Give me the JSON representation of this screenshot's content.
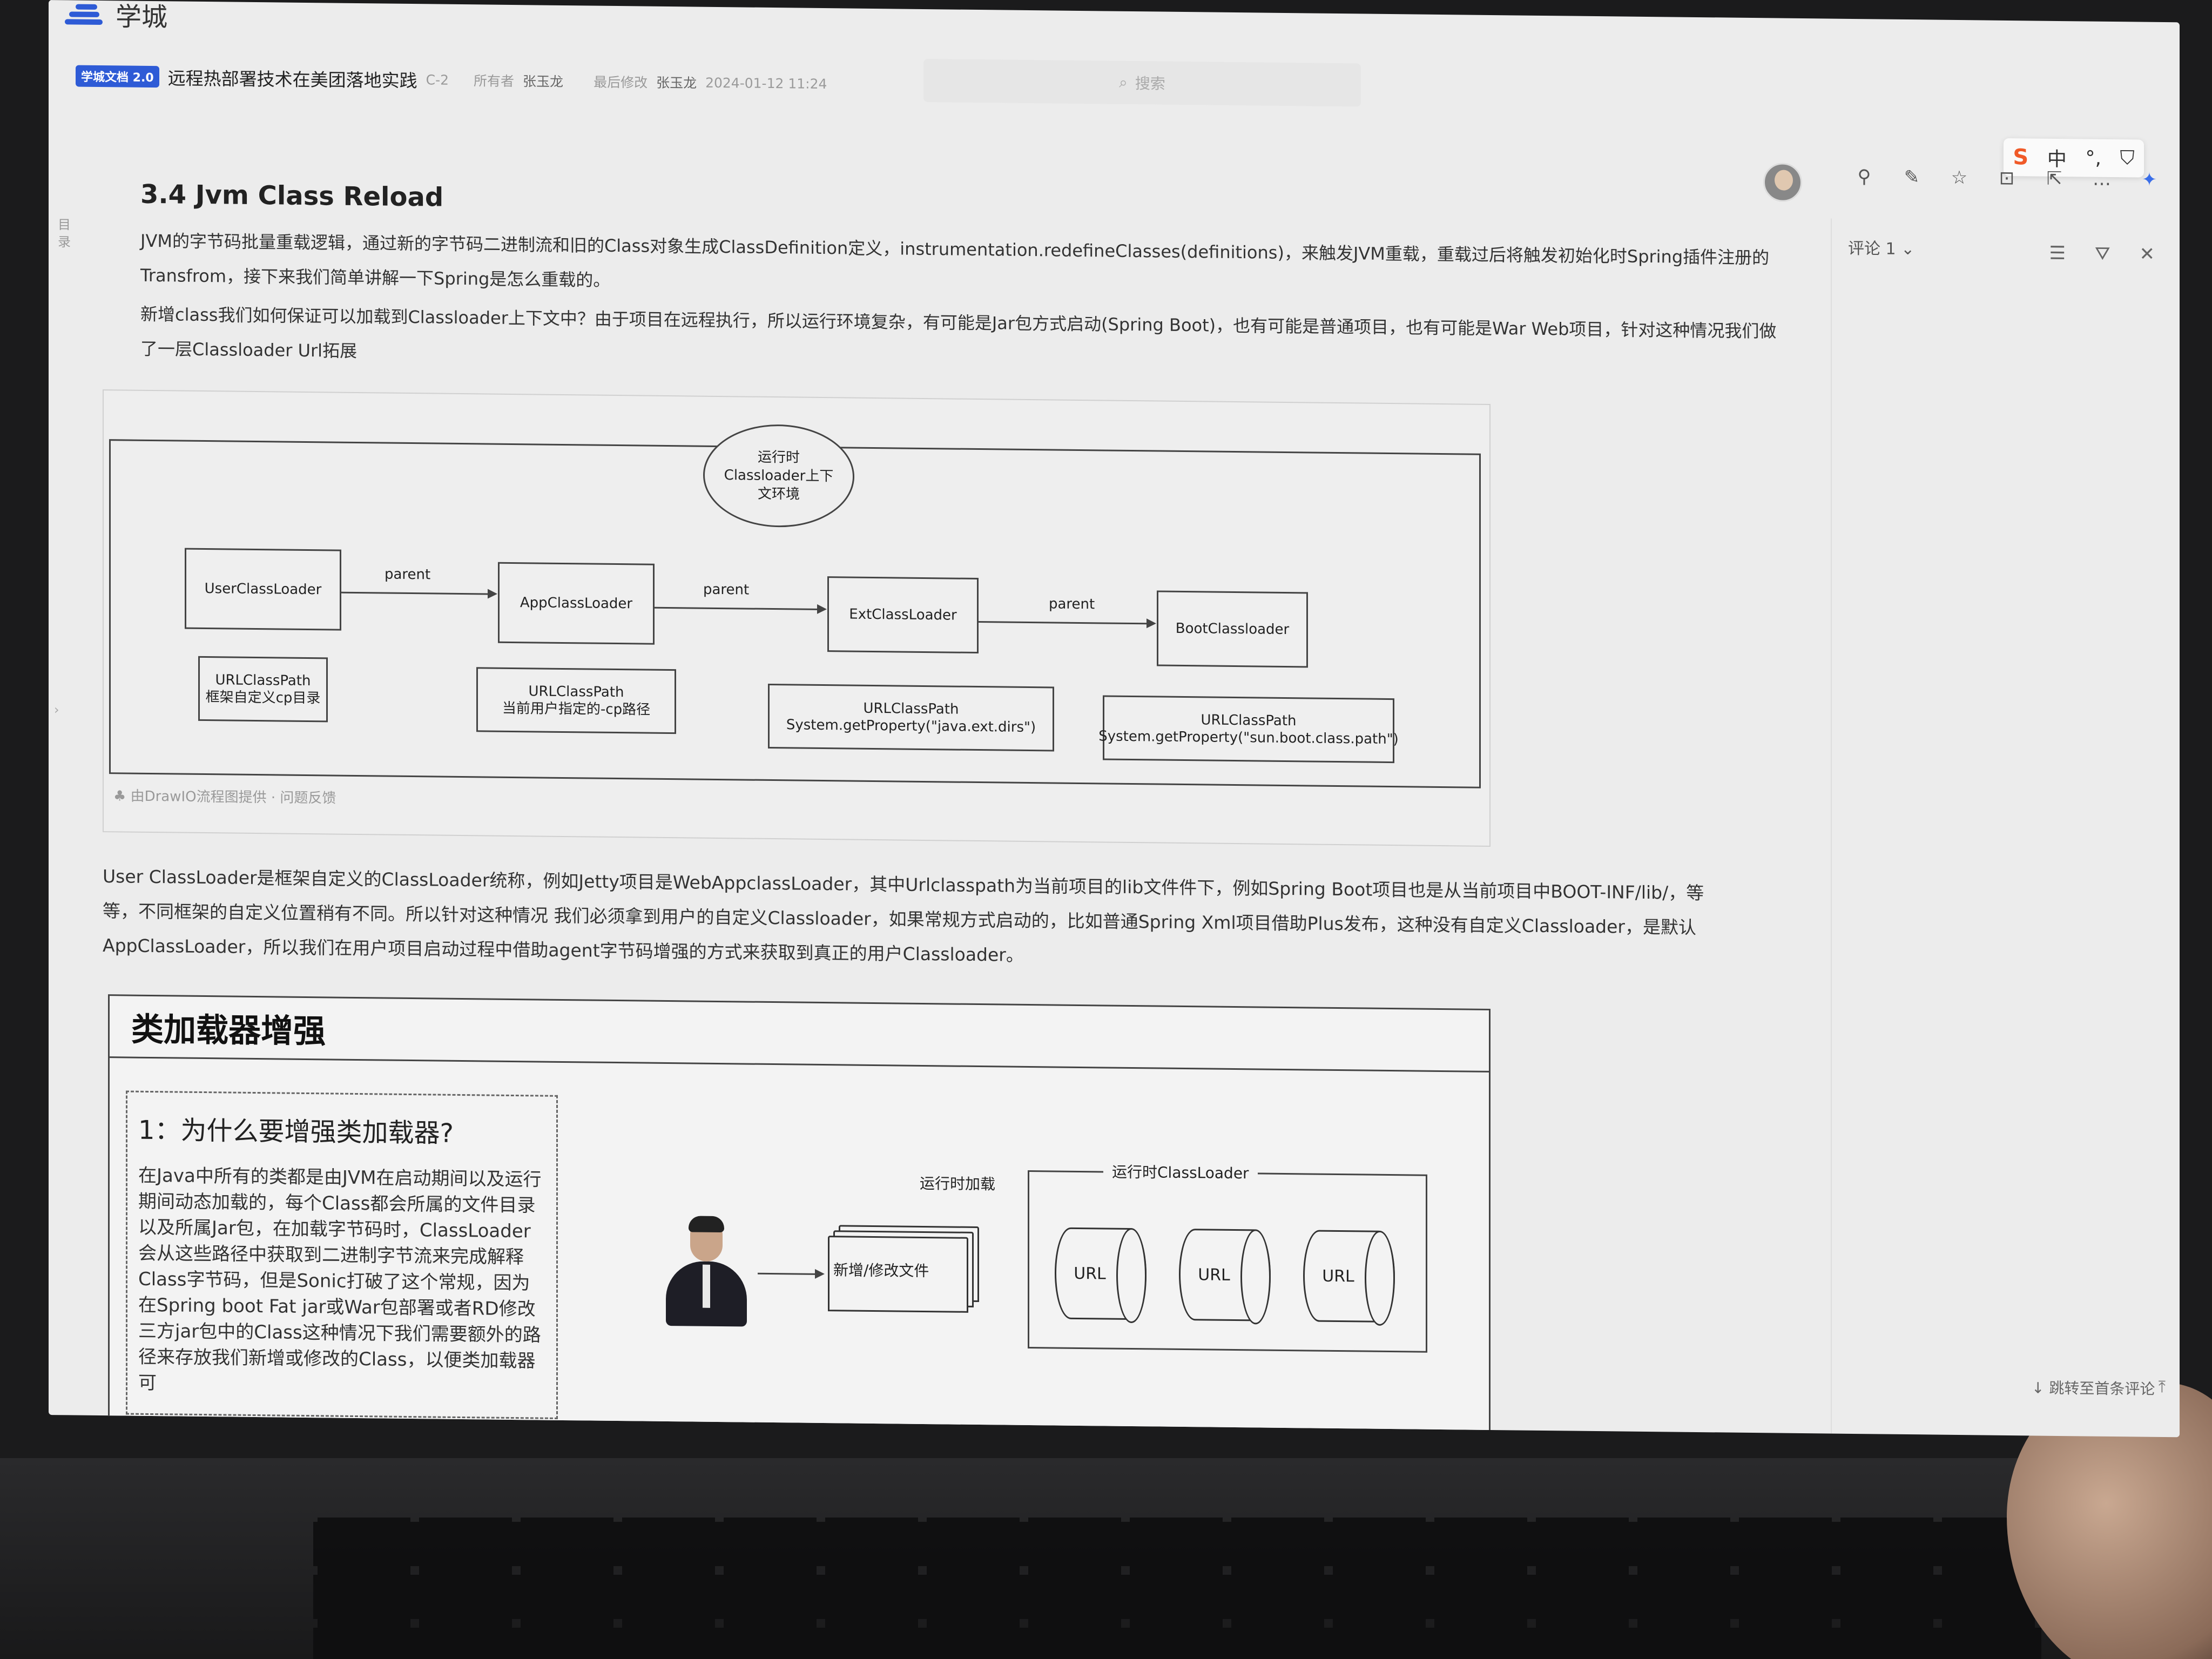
{
  "app": {
    "name": "学城"
  },
  "doc": {
    "badge": "学城文档 2.0",
    "title": "远程热部署技术在美团落地实践",
    "level": "C-2",
    "owner_label": "所有者",
    "owner": "张玉龙",
    "modified_label": "最后修改",
    "modifier": "张玉龙",
    "modified_time": "2024-01-12 11:24"
  },
  "search": {
    "placeholder": "搜索"
  },
  "toc": {
    "label": "目录"
  },
  "ime": {
    "logo": "S",
    "lang": "中"
  },
  "content": {
    "heading": "3.4 Jvm Class Reload",
    "p1": "JVM的字节码批量重载逻辑，通过新的字节码二进制流和旧的Class对象生成ClassDefinition定义，instrumentation.redefineClasses(definitions)，来触发JVM重载，重载过后将触发初始化时Spring插件注册的Transfrom，接下来我们简单讲解一下Spring是怎么重载的。",
    "p2": "新增class我们如何保证可以加载到Classloader上下文中？由于项目在远程执行，所以运行环境复杂，有可能是Jar包方式启动(Spring Boot)，也有可能是普通项目，也有可能是War Web项目，针对这种情况我们做了一层Classloader Url拓展",
    "p3": "User ClassLoader是框架自定义的ClassLoader统称，例如Jetty项目是WebAppclassLoader，其中Urlclasspath为当前项目的lib文件件下，例如Spring Boot项目也是从当前项目中BOOT-INF/lib/，等等，不同框架的自定义位置稍有不同。所以针对这种情况 我们必须拿到用户的自定义Classloader，如果常规方式启动的，比如普通Spring Xml项目借助Plus发布，这种没有自定义Classloader，是默认AppClassLoader，所以我们在用户项目启动过程中借助agent字节码增强的方式来获取到真正的用户Classloader。"
  },
  "diagram": {
    "context_label": "运行时Classloader上下文环境",
    "loaders": [
      "UserClassLoader",
      "AppClassLoader",
      "ExtClassLoader",
      "BootClassloader"
    ],
    "edge_label": "parent",
    "paths": [
      {
        "title": "URLClassPath",
        "desc": "框架自定义cp目录"
      },
      {
        "title": "URLClassPath",
        "desc": "当前用户指定的-cp路径"
      },
      {
        "title": "URLClassPath",
        "desc": "System.getProperty(\"java.ext.dirs\")"
      },
      {
        "title": "URLClassPath",
        "desc": "System.getProperty(\"sun.boot.class.path\")"
      }
    ],
    "credit": "由DrawIO流程图提供 · 问题反馈"
  },
  "enhance": {
    "title": "类加载器增强",
    "sub_heading": "1：为什么要增强类加载器?",
    "sub_body": "在Java中所有的类都是由JVM在启动期间以及运行期间动态加载的，每个Class都会所属的文件目录以及所属Jar包，在加载字节码时，ClassLoader会从这些路径中获取到二进制字节流来完成解释Class字节码，但是Sonic打破了这个常规，因为在Spring boot Fat jar或War包部署或者RD修改三方jar包中的Class这种情况下我们需要额外的路径来存放我们新增或修改的Class，以便类加载器可",
    "load_label": "运行时加载",
    "file_label": "新增/修改文件",
    "runtime_label": "运行时ClassLoader",
    "url_label": "URL"
  },
  "comments": {
    "header": "评论 1",
    "jump_first": "↓ 跳转至首条评论"
  }
}
